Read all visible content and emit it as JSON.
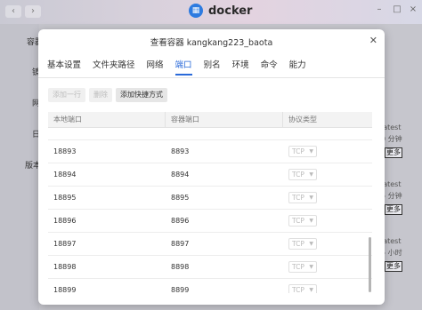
{
  "app": {
    "title": "docker",
    "logo_icon": "docker-logo-icon",
    "back_icon": "chevron-left-icon",
    "forward_icon": "chevron-right-icon"
  },
  "background": {
    "side_items": [
      "容器",
      "镜",
      "网",
      "日",
      "版本"
    ],
    "cards": [
      {
        "tag": "latest",
        "time": "0 分钟",
        "more": "更多"
      },
      {
        "tag": "latest",
        "time": "5 分钟",
        "more": "更多"
      },
      {
        "tag": "latest",
        "time": "5 小时",
        "more": "更多"
      }
    ]
  },
  "dialog": {
    "title": "查看容器 kangkang223_baota",
    "close_icon": "close-icon",
    "tabs": [
      {
        "label": "基本设置",
        "active": false
      },
      {
        "label": "文件夹路径",
        "active": false
      },
      {
        "label": "网络",
        "active": false
      },
      {
        "label": "端口",
        "active": true
      },
      {
        "label": "别名",
        "active": false
      },
      {
        "label": "环境",
        "active": false
      },
      {
        "label": "命令",
        "active": false
      },
      {
        "label": "能力",
        "active": false
      }
    ],
    "toolbar": {
      "add_row": "添加一行",
      "delete": "删除",
      "add_shortcut": "添加快捷方式"
    },
    "table": {
      "headers": [
        "本地端口",
        "容器端口",
        "协议类型"
      ],
      "rows": [
        {
          "local": "18893",
          "container": "8893",
          "protocol": "TCP"
        },
        {
          "local": "18894",
          "container": "8894",
          "protocol": "TCP"
        },
        {
          "local": "18895",
          "container": "8895",
          "protocol": "TCP"
        },
        {
          "local": "18896",
          "container": "8896",
          "protocol": "TCP"
        },
        {
          "local": "18897",
          "container": "8897",
          "protocol": "TCP"
        },
        {
          "local": "18898",
          "container": "8898",
          "protocol": "TCP"
        },
        {
          "local": "18899",
          "container": "8899",
          "protocol": "TCP"
        }
      ]
    }
  }
}
